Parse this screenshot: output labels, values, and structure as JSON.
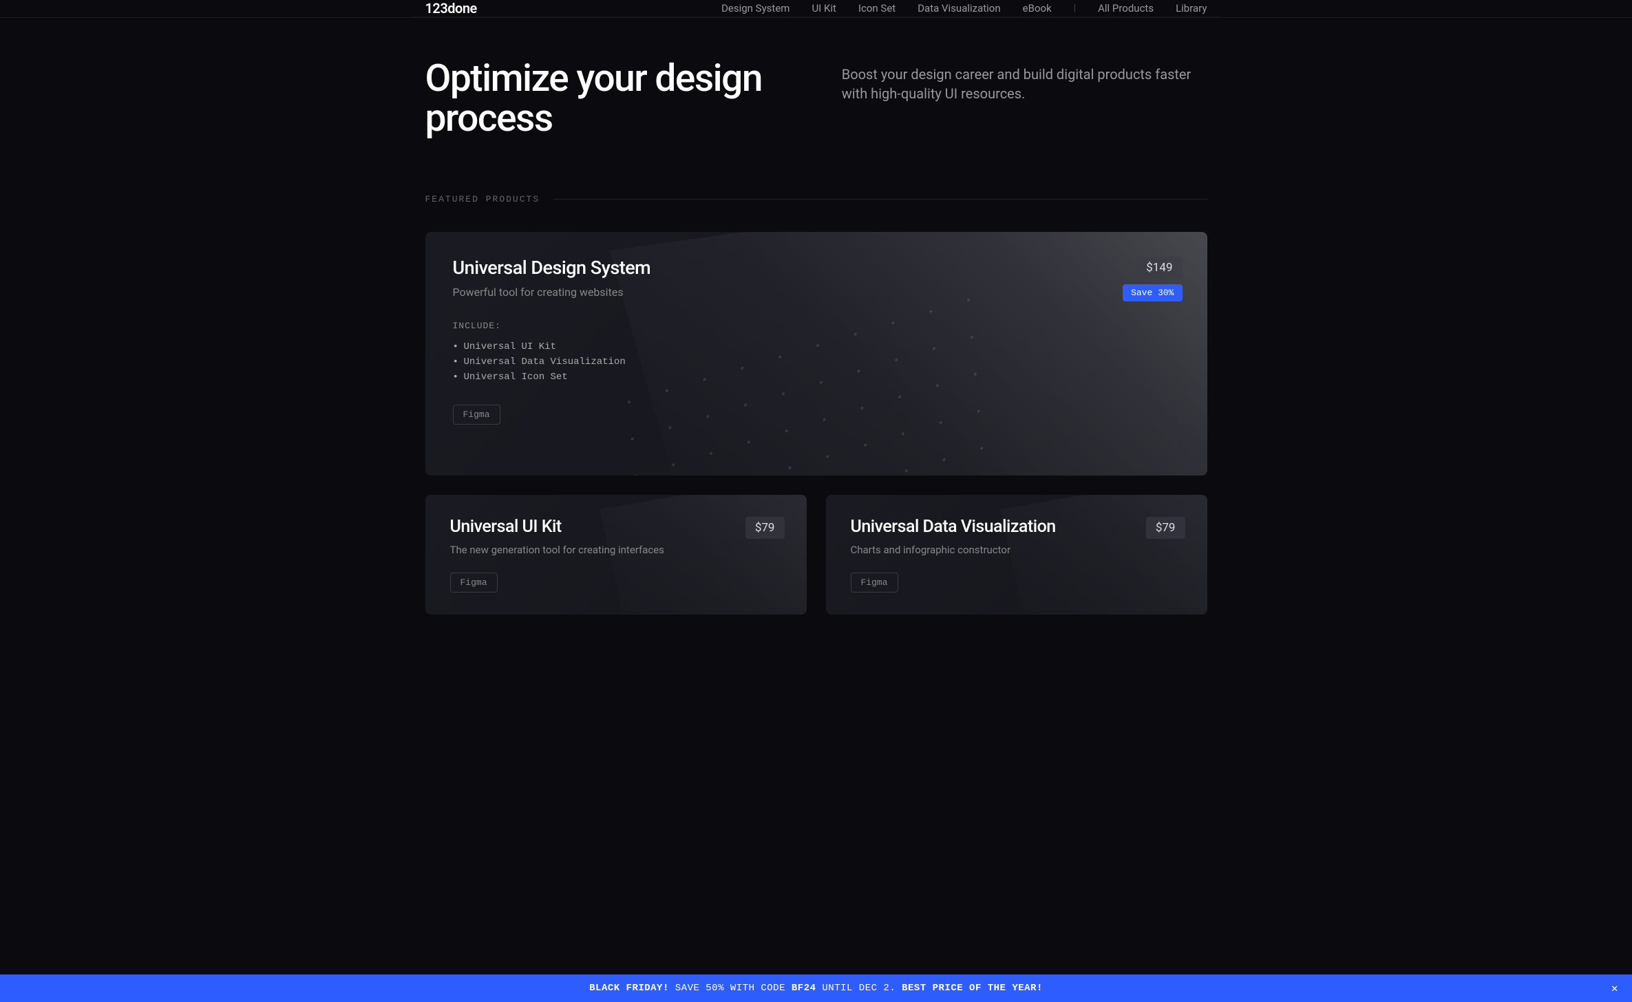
{
  "logo": "123done",
  "nav": {
    "items": [
      "Design System",
      "UI Kit",
      "Icon Set",
      "Data Visualization",
      "eBook"
    ],
    "secondary": [
      "All Products",
      "Library"
    ]
  },
  "hero": {
    "title": "Optimize your design process",
    "subtitle": "Boost your design career and build digital products faster with high-quality UI resources."
  },
  "section_label": "FEATURED PRODUCTS",
  "featured": {
    "title": "Universal Design System",
    "subtitle": "Powerful tool for creating websites",
    "include_label": "INCLUDE:",
    "includes": [
      "Universal UI Kit",
      "Universal Data Visualization",
      "Universal Icon Set"
    ],
    "tag": "Figma",
    "price": "$149",
    "save": "Save 30%"
  },
  "cards": [
    {
      "title": "Universal UI Kit",
      "subtitle": "The new generation tool for creating interfaces",
      "tag": "Figma",
      "price": "$79"
    },
    {
      "title": "Universal Data Visualization",
      "subtitle": "Charts and infographic constructor",
      "tag": "Figma",
      "price": "$79"
    }
  ],
  "promo": {
    "bold1": "BLACK FRIDAY!",
    "text1": " SAVE 50% WITH CODE ",
    "bold2": "BF24",
    "text2": " UNTIL DEC 2. ",
    "bold3": "BEST PRICE OF THE YEAR!"
  }
}
